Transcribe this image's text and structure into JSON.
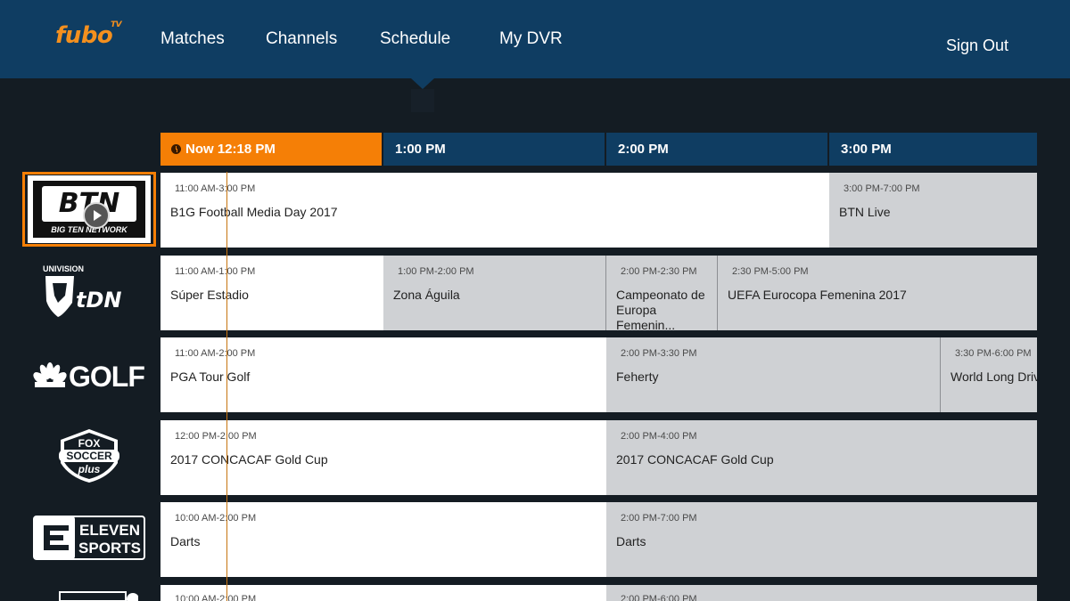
{
  "header": {
    "logo": "fubo",
    "logo_sup": "TV",
    "nav": [
      "Matches",
      "Channels",
      "Schedule",
      "My DVR"
    ],
    "sign_out": "Sign Out"
  },
  "timebar": {
    "now": "Now 12:18 PM",
    "slots": [
      "1:00 PM",
      "2:00 PM",
      "3:00 PM"
    ]
  },
  "channels": [
    {
      "name": "btn-logo",
      "logo_text": "BTN",
      "logo_sub": "BIG TEN NETWORK",
      "programs": [
        {
          "time": "11:00 AM-3:00 PM",
          "title": "B1G Football Media Day 2017"
        },
        {
          "time": "3:00 PM-7:00 PM",
          "title": "BTN Live"
        }
      ]
    },
    {
      "name": "univision-tdn-logo",
      "logo_text": "tDN",
      "logo_sub": "UNIVISION",
      "programs": [
        {
          "time": "11:00 AM-1:00 PM",
          "title": "Súper Estadio"
        },
        {
          "time": "1:00 PM-2:00 PM",
          "title": "Zona Águila"
        },
        {
          "time": "2:00 PM-2:30 PM",
          "title": "Campeonato de Europa Femenin..."
        },
        {
          "time": "2:30 PM-5:00 PM",
          "title": "UEFA Eurocopa Femenina 2017"
        }
      ]
    },
    {
      "name": "golf-logo",
      "logo_text": "GOLF",
      "programs": [
        {
          "time": "11:00 AM-2:00 PM",
          "title": "PGA Tour Golf"
        },
        {
          "time": "2:00 PM-3:30 PM",
          "title": "Feherty"
        },
        {
          "time": "3:30 PM-6:00 PM",
          "title": "World Long Drive"
        }
      ]
    },
    {
      "name": "fox-soccer-plus-logo",
      "logo_text": [
        "FOX",
        "SOCCER",
        "plus"
      ],
      "programs": [
        {
          "time": "12:00 PM-2:00 PM",
          "title": "2017 CONCACAF Gold Cup"
        },
        {
          "time": "2:00 PM-4:00 PM",
          "title": "2017 CONCACAF Gold Cup"
        }
      ]
    },
    {
      "name": "eleven-sports-logo",
      "logo_text": [
        "ELEVEN",
        "SPORTS"
      ],
      "programs": [
        {
          "time": "10:00 AM-2:00 PM",
          "title": "Darts"
        },
        {
          "time": "2:00 PM-7:00 PM",
          "title": "Darts"
        }
      ]
    },
    {
      "name": "partial-channel-logo",
      "programs": [
        {
          "time": "10:00 AM-2:00 PM",
          "title": ""
        },
        {
          "time": "2:00 PM-6:00 PM",
          "title": ""
        }
      ]
    }
  ],
  "colors": {
    "header_bg": "#0f3d62",
    "accent": "#f57f06",
    "page_bg": "#141c23",
    "current_program_bg": "#ffffff",
    "future_program_bg": "#cfd1d4"
  }
}
